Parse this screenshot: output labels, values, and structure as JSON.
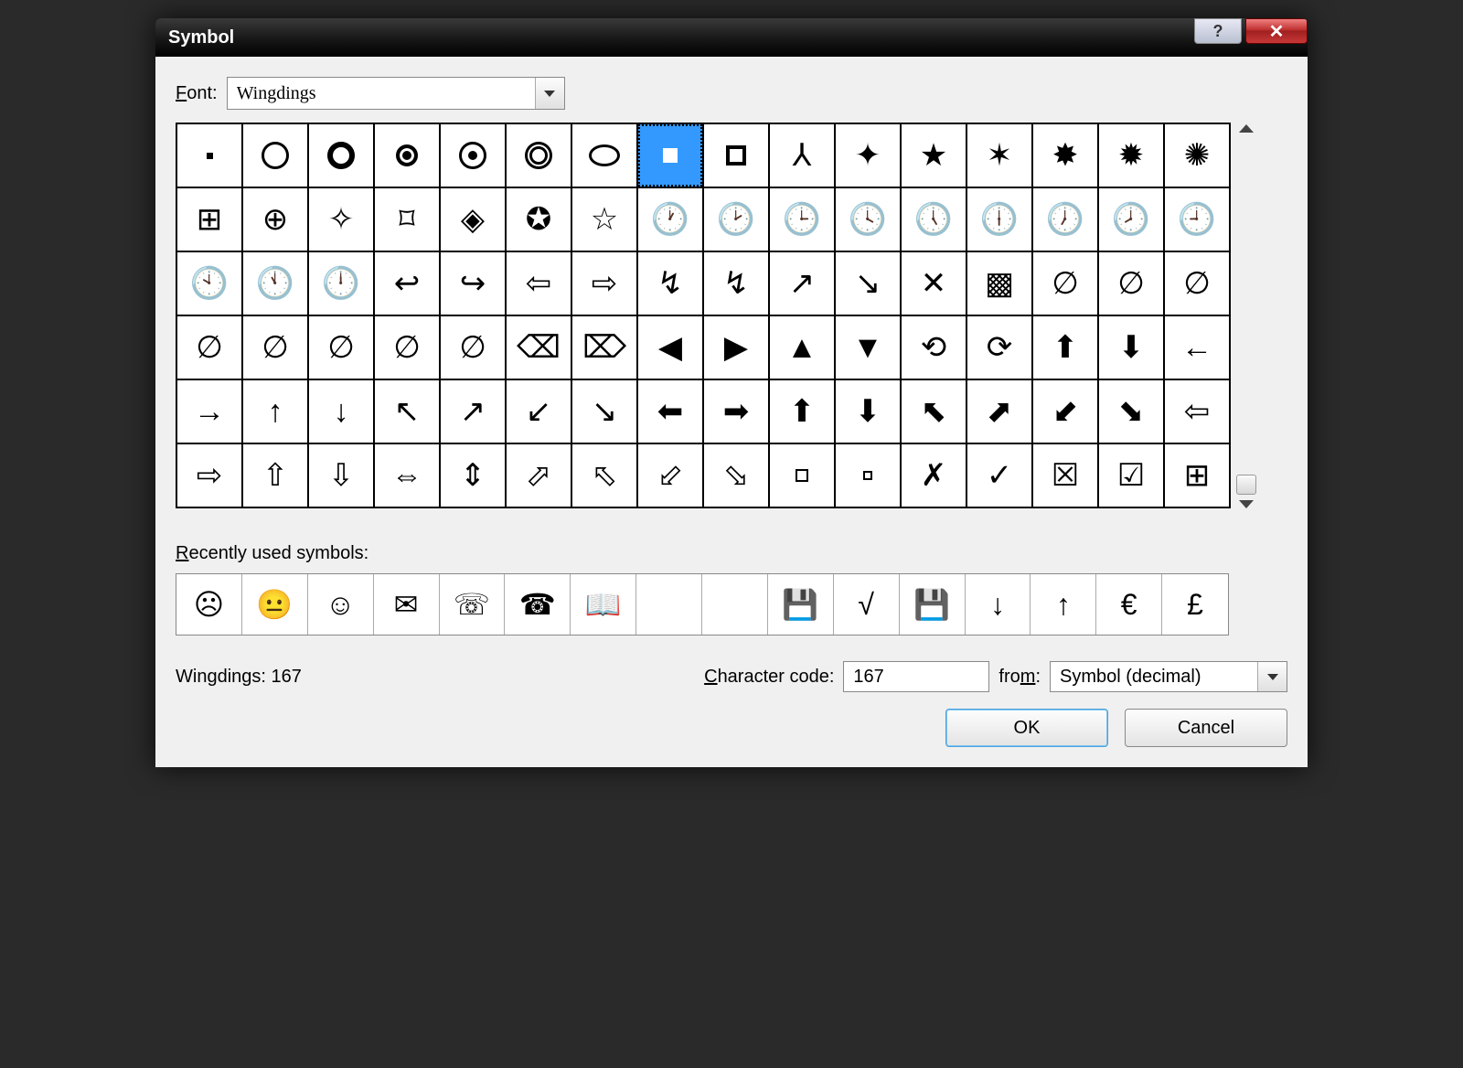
{
  "window": {
    "title": "Symbol"
  },
  "font": {
    "label": "Font:",
    "value": "Wingdings"
  },
  "grid": {
    "columns": 16,
    "rows": 6,
    "selected_index": 7,
    "cells": [
      {
        "name": "dot",
        "glyph": "",
        "css": "g-dot"
      },
      {
        "name": "circle-outline",
        "glyph": "",
        "css": "g-circ"
      },
      {
        "name": "circle-thick",
        "glyph": "",
        "css": "g-circ-thick"
      },
      {
        "name": "circle-filled",
        "glyph": "",
        "css": "g-circ-fill"
      },
      {
        "name": "circle-dot",
        "glyph": "",
        "css": "g-circ-dot"
      },
      {
        "name": "target",
        "glyph": "",
        "css": "g-target"
      },
      {
        "name": "oval",
        "glyph": "",
        "css": "g-oval"
      },
      {
        "name": "white-square",
        "glyph": "",
        "css": "g-square-fill-w"
      },
      {
        "name": "square-outline",
        "glyph": "",
        "css": "g-square"
      },
      {
        "name": "tripod",
        "glyph": "⅄"
      },
      {
        "name": "plus-sparkle",
        "glyph": "✦"
      },
      {
        "name": "star-5",
        "glyph": "★"
      },
      {
        "name": "star-6",
        "glyph": "✶"
      },
      {
        "name": "starburst-8",
        "glyph": "✸"
      },
      {
        "name": "starburst-12",
        "glyph": "✹"
      },
      {
        "name": "starburst-outline",
        "glyph": "✺"
      },
      {
        "name": "square-plus",
        "glyph": "⊞"
      },
      {
        "name": "crosshair",
        "glyph": "⊕"
      },
      {
        "name": "sparkle-4",
        "glyph": "✧"
      },
      {
        "name": "frame-corners",
        "glyph": "⌑"
      },
      {
        "name": "diamond-question",
        "glyph": "◈"
      },
      {
        "name": "star-circle-black",
        "glyph": "✪"
      },
      {
        "name": "star-outline",
        "glyph": "☆"
      },
      {
        "name": "clock-1",
        "glyph": "🕐"
      },
      {
        "name": "clock-2",
        "glyph": "🕑"
      },
      {
        "name": "clock-3",
        "glyph": "🕒"
      },
      {
        "name": "clock-4",
        "glyph": "🕓"
      },
      {
        "name": "clock-5",
        "glyph": "🕔"
      },
      {
        "name": "clock-6",
        "glyph": "🕕"
      },
      {
        "name": "clock-7",
        "glyph": "🕖"
      },
      {
        "name": "clock-8",
        "glyph": "🕗"
      },
      {
        "name": "clock-9",
        "glyph": "🕘"
      },
      {
        "name": "clock-10",
        "glyph": "🕙"
      },
      {
        "name": "clock-11",
        "glyph": "🕚"
      },
      {
        "name": "clock-12",
        "glyph": "🕛"
      },
      {
        "name": "arrow-curve-left",
        "glyph": "↩"
      },
      {
        "name": "arrow-curve-right",
        "glyph": "↪"
      },
      {
        "name": "arrow-ribbon-left",
        "glyph": "⇦"
      },
      {
        "name": "arrow-ribbon-right",
        "glyph": "⇨"
      },
      {
        "name": "arrow-zig-left",
        "glyph": "↯"
      },
      {
        "name": "arrow-zig-right",
        "glyph": "↯"
      },
      {
        "name": "arrow-zig-up",
        "glyph": "↗"
      },
      {
        "name": "arrow-zig-down",
        "glyph": "↘"
      },
      {
        "name": "leaf-4",
        "glyph": "✕"
      },
      {
        "name": "leaf-4-black",
        "glyph": "▩"
      },
      {
        "name": "swirl-1",
        "glyph": "∅"
      },
      {
        "name": "swirl-2",
        "glyph": "∅"
      },
      {
        "name": "swirl-3",
        "glyph": "∅"
      },
      {
        "name": "swirl-4",
        "glyph": "∅"
      },
      {
        "name": "swirl-5",
        "glyph": "∅"
      },
      {
        "name": "swirl-6",
        "glyph": "∅"
      },
      {
        "name": "swirl-7",
        "glyph": "∅"
      },
      {
        "name": "swirl-8",
        "glyph": "∅"
      },
      {
        "name": "hex-x-outline",
        "glyph": "⌫"
      },
      {
        "name": "hex-x-fill",
        "glyph": "⌦"
      },
      {
        "name": "pointer-left",
        "glyph": "◀"
      },
      {
        "name": "pointer-right",
        "glyph": "▶"
      },
      {
        "name": "pointer-up",
        "glyph": "▲"
      },
      {
        "name": "pointer-down",
        "glyph": "▼"
      },
      {
        "name": "arrow-circle-lr",
        "glyph": "⟲"
      },
      {
        "name": "arrow-circle-rl",
        "glyph": "⟳"
      },
      {
        "name": "split-up",
        "glyph": "⬆"
      },
      {
        "name": "split-down",
        "glyph": "⬇"
      },
      {
        "name": "arrow-left-thin",
        "glyph": "←"
      },
      {
        "name": "arrow-right-thin",
        "glyph": "→"
      },
      {
        "name": "arrow-up-thin",
        "glyph": "↑"
      },
      {
        "name": "arrow-down-thin",
        "glyph": "↓"
      },
      {
        "name": "arrow-nw-thin",
        "glyph": "↖"
      },
      {
        "name": "arrow-ne-thin",
        "glyph": "↗"
      },
      {
        "name": "arrow-sw-thin",
        "glyph": "↙"
      },
      {
        "name": "arrow-se-thin",
        "glyph": "↘"
      },
      {
        "name": "arrow-left-bold",
        "glyph": "⬅"
      },
      {
        "name": "arrow-right-bold",
        "glyph": "➡"
      },
      {
        "name": "arrow-up-bold",
        "glyph": "⬆"
      },
      {
        "name": "arrow-down-bold",
        "glyph": "⬇"
      },
      {
        "name": "arrow-nw-bold",
        "glyph": "⬉"
      },
      {
        "name": "arrow-ne-bold",
        "glyph": "⬈"
      },
      {
        "name": "arrow-sw-bold",
        "glyph": "⬋"
      },
      {
        "name": "arrow-se-bold",
        "glyph": "⬊"
      },
      {
        "name": "arrow-left-hollow",
        "glyph": "⇦"
      },
      {
        "name": "arrow-right-hollow",
        "glyph": "⇨"
      },
      {
        "name": "arrow-up-hollow",
        "glyph": "⇧"
      },
      {
        "name": "arrow-down-hollow",
        "glyph": "⇩"
      },
      {
        "name": "arrow-lr-hollow",
        "glyph": "⇔"
      },
      {
        "name": "arrow-ud-hollow",
        "glyph": "⇕"
      },
      {
        "name": "arrow-ne-hollow",
        "glyph": "⬀"
      },
      {
        "name": "arrow-nw-hollow",
        "glyph": "⬁"
      },
      {
        "name": "arrow-sw-hollow",
        "glyph": "⬃"
      },
      {
        "name": "arrow-se-hollow",
        "glyph": "⬂"
      },
      {
        "name": "rect-hollow",
        "glyph": "",
        "css": "g-square-sm"
      },
      {
        "name": "rect-hollow-small",
        "glyph": "",
        "css": "g-square-xs"
      },
      {
        "name": "x-mark",
        "glyph": "✗"
      },
      {
        "name": "check-mark",
        "glyph": "✓"
      },
      {
        "name": "box-x",
        "glyph": "☒"
      },
      {
        "name": "box-check",
        "glyph": "☑"
      },
      {
        "name": "windows-logo",
        "glyph": "⊞"
      }
    ]
  },
  "recent": {
    "label": "Recently used symbols:",
    "cells": [
      {
        "name": "face-sad",
        "glyph": "☹"
      },
      {
        "name": "face-neutral",
        "glyph": "😐"
      },
      {
        "name": "face-happy",
        "glyph": "☺"
      },
      {
        "name": "envelope",
        "glyph": "✉"
      },
      {
        "name": "phone-circle",
        "glyph": "☏"
      },
      {
        "name": "telephone",
        "glyph": "☎"
      },
      {
        "name": "open-book",
        "glyph": "📖"
      },
      {
        "name": "blank-1",
        "glyph": ""
      },
      {
        "name": "blank-2",
        "glyph": ""
      },
      {
        "name": "floppy-label",
        "glyph": "💾"
      },
      {
        "name": "radical",
        "glyph": "√"
      },
      {
        "name": "floppy",
        "glyph": "💾"
      },
      {
        "name": "arrow-down",
        "glyph": "↓"
      },
      {
        "name": "arrow-up",
        "glyph": "↑"
      },
      {
        "name": "euro",
        "glyph": "€"
      },
      {
        "name": "pound",
        "glyph": "£"
      }
    ]
  },
  "status": {
    "text": "Wingdings: 167"
  },
  "char_code": {
    "label": "Character code:",
    "value": "167"
  },
  "from": {
    "label": "from:",
    "value": "Symbol (decimal)"
  },
  "buttons": {
    "ok": "OK",
    "cancel": "Cancel"
  }
}
